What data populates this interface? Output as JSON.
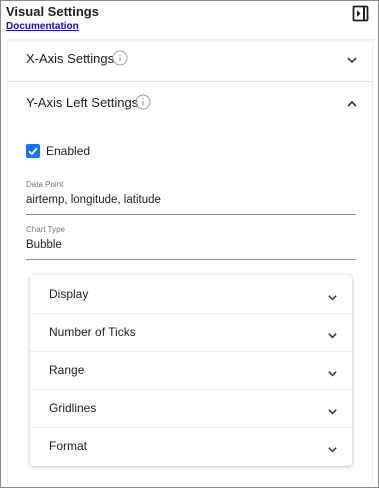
{
  "header": {
    "title": "Visual Settings",
    "documentation_link": "Documentation",
    "collapse_icon": "panel-collapse-icon"
  },
  "sections": {
    "x_axis": {
      "label": "X-Axis Settings",
      "expanded": false
    },
    "y_axis_left": {
      "label": "Y-Axis Left Settings",
      "expanded": true
    }
  },
  "y_axis_left": {
    "enabled": {
      "label": "Enabled",
      "checked": true
    },
    "data_point": {
      "label": "Data Point",
      "value": "airtemp, longitude, latitude"
    },
    "chart_type": {
      "label": "Chart Type",
      "value": "Bubble"
    }
  },
  "subsections": [
    {
      "label": "Display"
    },
    {
      "label": "Number of Ticks"
    },
    {
      "label": "Range"
    },
    {
      "label": "Gridlines"
    },
    {
      "label": "Format"
    }
  ],
  "colors": {
    "accent": "#1a73e8",
    "link": "#1a0dab",
    "text": "#212121",
    "muted": "#757575"
  }
}
